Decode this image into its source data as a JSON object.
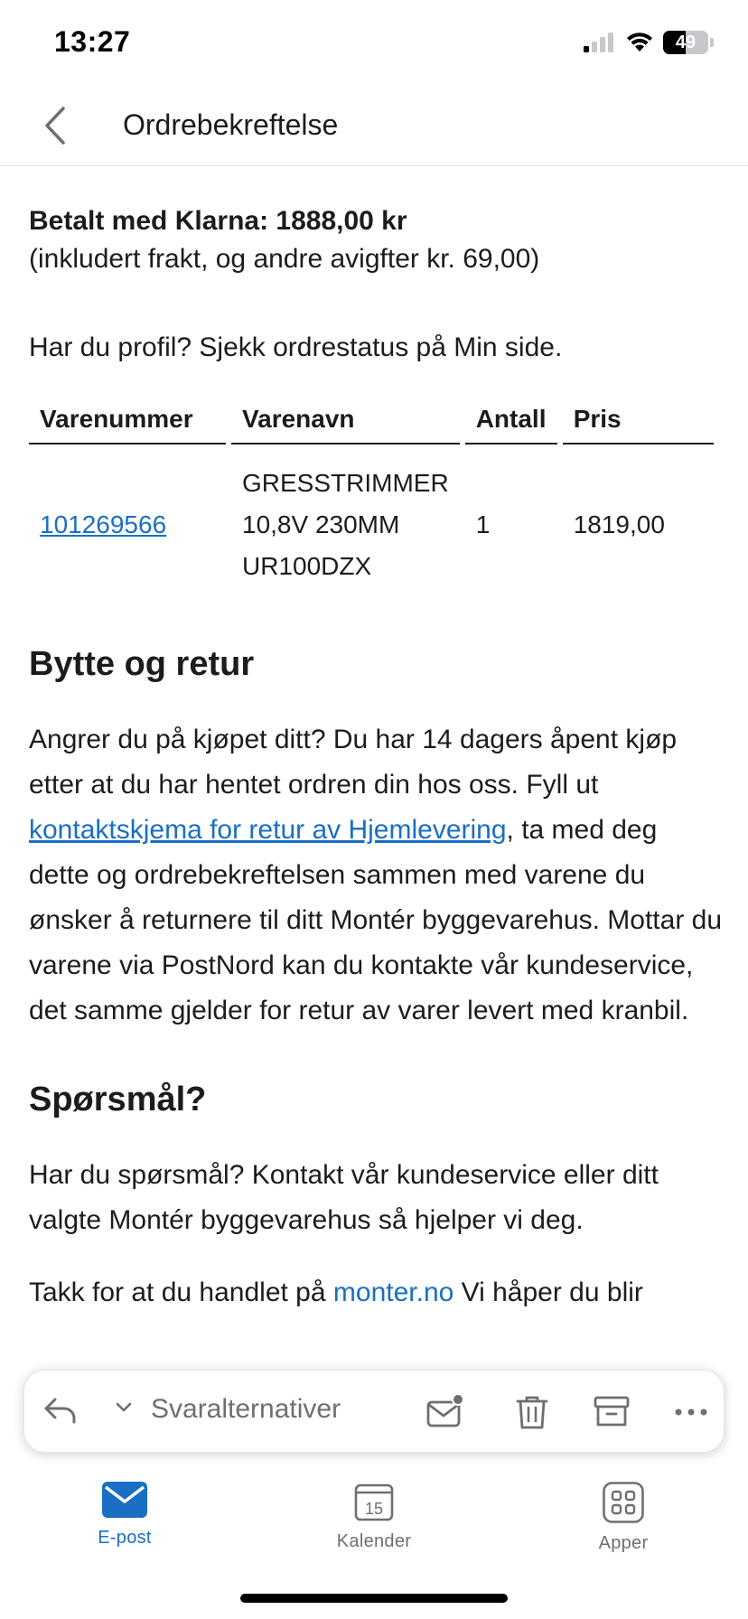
{
  "status_bar": {
    "time": "13:27",
    "battery": "49",
    "battery_level_percent": 49
  },
  "nav": {
    "title": "Ordrebekreftelse"
  },
  "email": {
    "paid_line": "Betalt med Klarna: 1888,00 kr",
    "included_line": "(inkludert frakt, og andre avigfter kr. 69,00)",
    "profile_line": "Har du profil? Sjekk ordrestatus på Min side.",
    "table": {
      "headers": [
        "Varenummer",
        "Varenavn",
        "Antall",
        "Pris"
      ],
      "rows": [
        {
          "item_number": "101269566",
          "name_lines": [
            "GRESSTRIMMER",
            "10,8V 230MM",
            "UR100DZX"
          ],
          "quantity": "1",
          "price": "1819,00"
        }
      ]
    },
    "return_heading": "Bytte og retur",
    "return_text_before": "Angrer du på kjøpet ditt? Du har 14 dagers åpent kjøp etter at du har hentet ordren din hos oss. Fyll ut ",
    "return_link": "kontaktskjema for retur av Hjemlevering",
    "return_text_after": ", ta med deg dette og ordrebekreftelsen sammen med varene du ønsker å returnere til ditt Montér byggevarehus. Mottar du varene via PostNord kan du kontakte vår kundeservice, det samme gjelder for retur av varer levert med kranbil.",
    "questions_heading": "Spørsmål?",
    "questions_text": "Har du spørsmål? Kontakt vår kundeservice eller ditt valgte Montér byggevarehus så hjelper vi deg.",
    "thanks_before": "Takk for at du handlet på ",
    "thanks_link": "monter.no",
    "thanks_after": " Vi håper du blir"
  },
  "action_bar": {
    "reply_label": "Svaralternativer"
  },
  "tabs": [
    {
      "label": "E-post",
      "icon": "mail-icon",
      "active": true
    },
    {
      "label": "Kalender",
      "icon": "calendar-icon",
      "day": "15",
      "active": false
    },
    {
      "label": "Apper",
      "icon": "apps-icon",
      "active": false
    }
  ],
  "colors": {
    "accent": "#1a6fc4",
    "text": "#1c1c1e",
    "muted": "#6e6e73"
  }
}
